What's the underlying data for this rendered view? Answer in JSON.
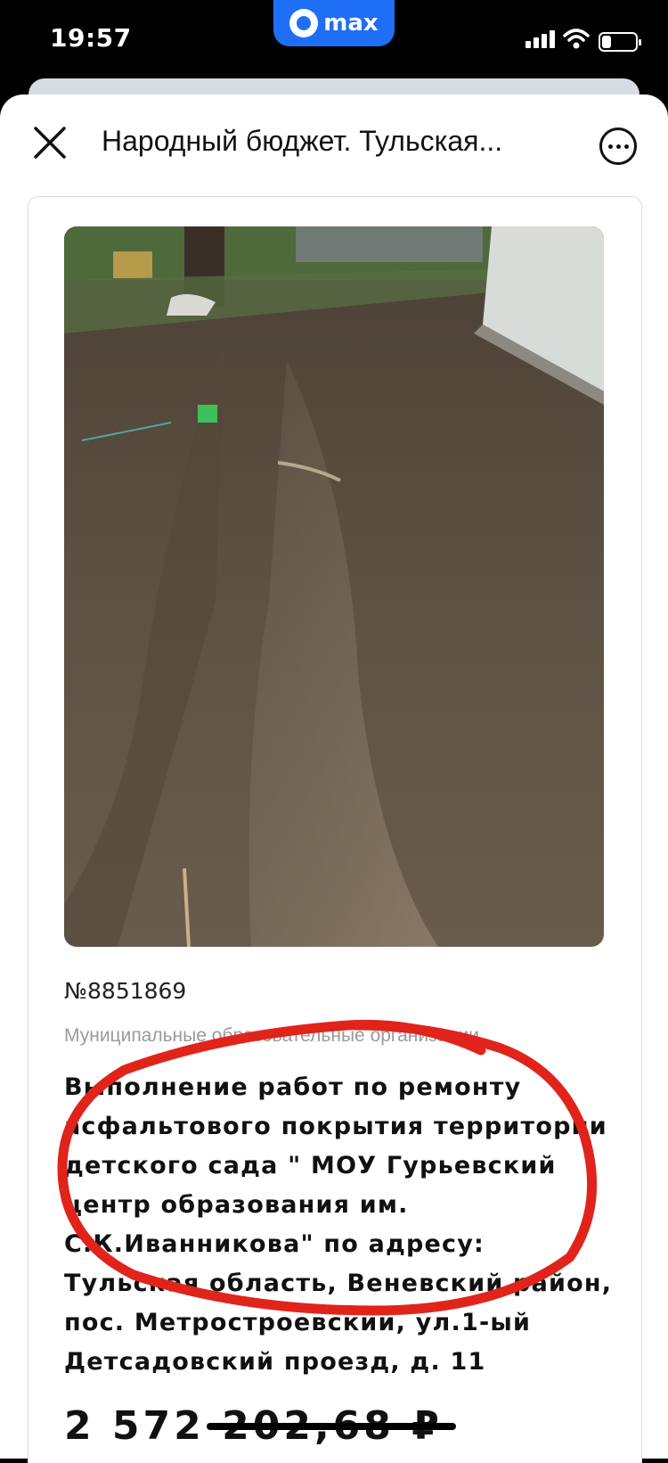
{
  "status_bar": {
    "time": "19:57",
    "app_badge": "max"
  },
  "header": {
    "title": "Народный бюджет. Тульская..."
  },
  "project": {
    "number": "№8851869",
    "category": "Муниципальные образовательные организации",
    "description": "Выполнение работ по ремонту асфальтового покрытия территории детского сада \" МОУ Гурьевский центр образования им. С.К.Иванникова\" по адресу: Тульская область, Веневский район, пос. Метростроевский, ул.1-ый Детсадовский проезд, д. 11",
    "price": "2 572 202,68 ₽"
  },
  "colors": {
    "accent": "#1e6ff5",
    "annotation": "#e0241b"
  },
  "icons": {
    "close": "close-icon",
    "more": "more-icon",
    "wifi": "wifi-icon",
    "signal": "signal-icon",
    "battery": "battery-icon"
  }
}
